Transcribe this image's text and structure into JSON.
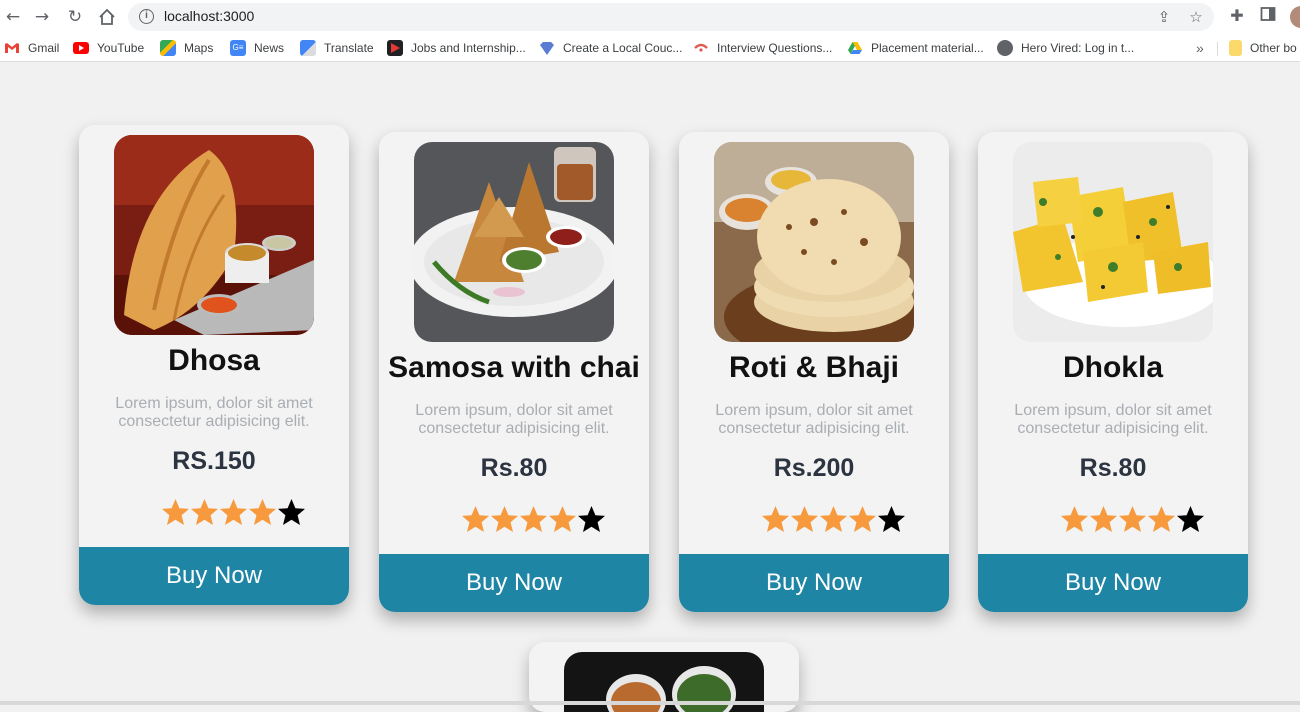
{
  "browser": {
    "url": "localhost:3000",
    "nav": {
      "back_icon": "arrow-left-icon",
      "forward_icon": "arrow-right-icon",
      "reload_icon": "reload-icon",
      "home_icon": "home-icon"
    },
    "bookmarks": [
      {
        "label": "Gmail",
        "icon": "gmail-icon",
        "color": "#ea4335"
      },
      {
        "label": "YouTube",
        "icon": "youtube-icon",
        "color": "#ff0000"
      },
      {
        "label": "Maps",
        "icon": "maps-icon",
        "color": "#34a853"
      },
      {
        "label": "News",
        "icon": "news-icon",
        "color": "#4285f4"
      },
      {
        "label": "Translate",
        "icon": "translate-icon",
        "color": "#4285f4"
      },
      {
        "label": "Jobs and Internship...",
        "icon": "jobs-icon",
        "color": "#b71c1c"
      },
      {
        "label": "Create a Local Couc...",
        "icon": "couch-icon",
        "color": "#5b7bd5"
      },
      {
        "label": "Interview Questions...",
        "icon": "interview-icon",
        "color": "#e05a4f"
      },
      {
        "label": "Placement material...",
        "icon": "drive-icon",
        "color": "#fbbc04"
      },
      {
        "label": "Hero Vired: Log in t...",
        "icon": "globe-icon",
        "color": "#5f6368"
      }
    ],
    "bookmarks_more": "»",
    "other_bookmarks": "Other bo"
  },
  "products": [
    {
      "name": "Dhosa",
      "description": "Lorem ipsum, dolor sit amet consectetur adipisicing elit.",
      "price": "RS.150",
      "rating": 4,
      "max_rating": 5,
      "button": "Buy Now"
    },
    {
      "name": "Samosa with chai",
      "description": "Lorem ipsum, dolor sit amet consectetur adipisicing elit.",
      "price": "Rs.80",
      "rating": 4,
      "max_rating": 5,
      "button": "Buy Now"
    },
    {
      "name": "Roti & Bhaji",
      "description": "Lorem ipsum, dolor sit amet consectetur adipisicing elit.",
      "price": "Rs.200",
      "rating": 4,
      "max_rating": 5,
      "button": "Buy Now"
    },
    {
      "name": "Dhokla",
      "description": "Lorem ipsum, dolor sit amet consectetur adipisicing elit.",
      "price": "Rs.80",
      "rating": 4,
      "max_rating": 5,
      "button": "Buy Now"
    }
  ],
  "colors": {
    "button_bg": "#1f85a5",
    "star_filled": "#f79a3e",
    "star_empty": "#000000",
    "page_bg": "#f1f1f1"
  }
}
